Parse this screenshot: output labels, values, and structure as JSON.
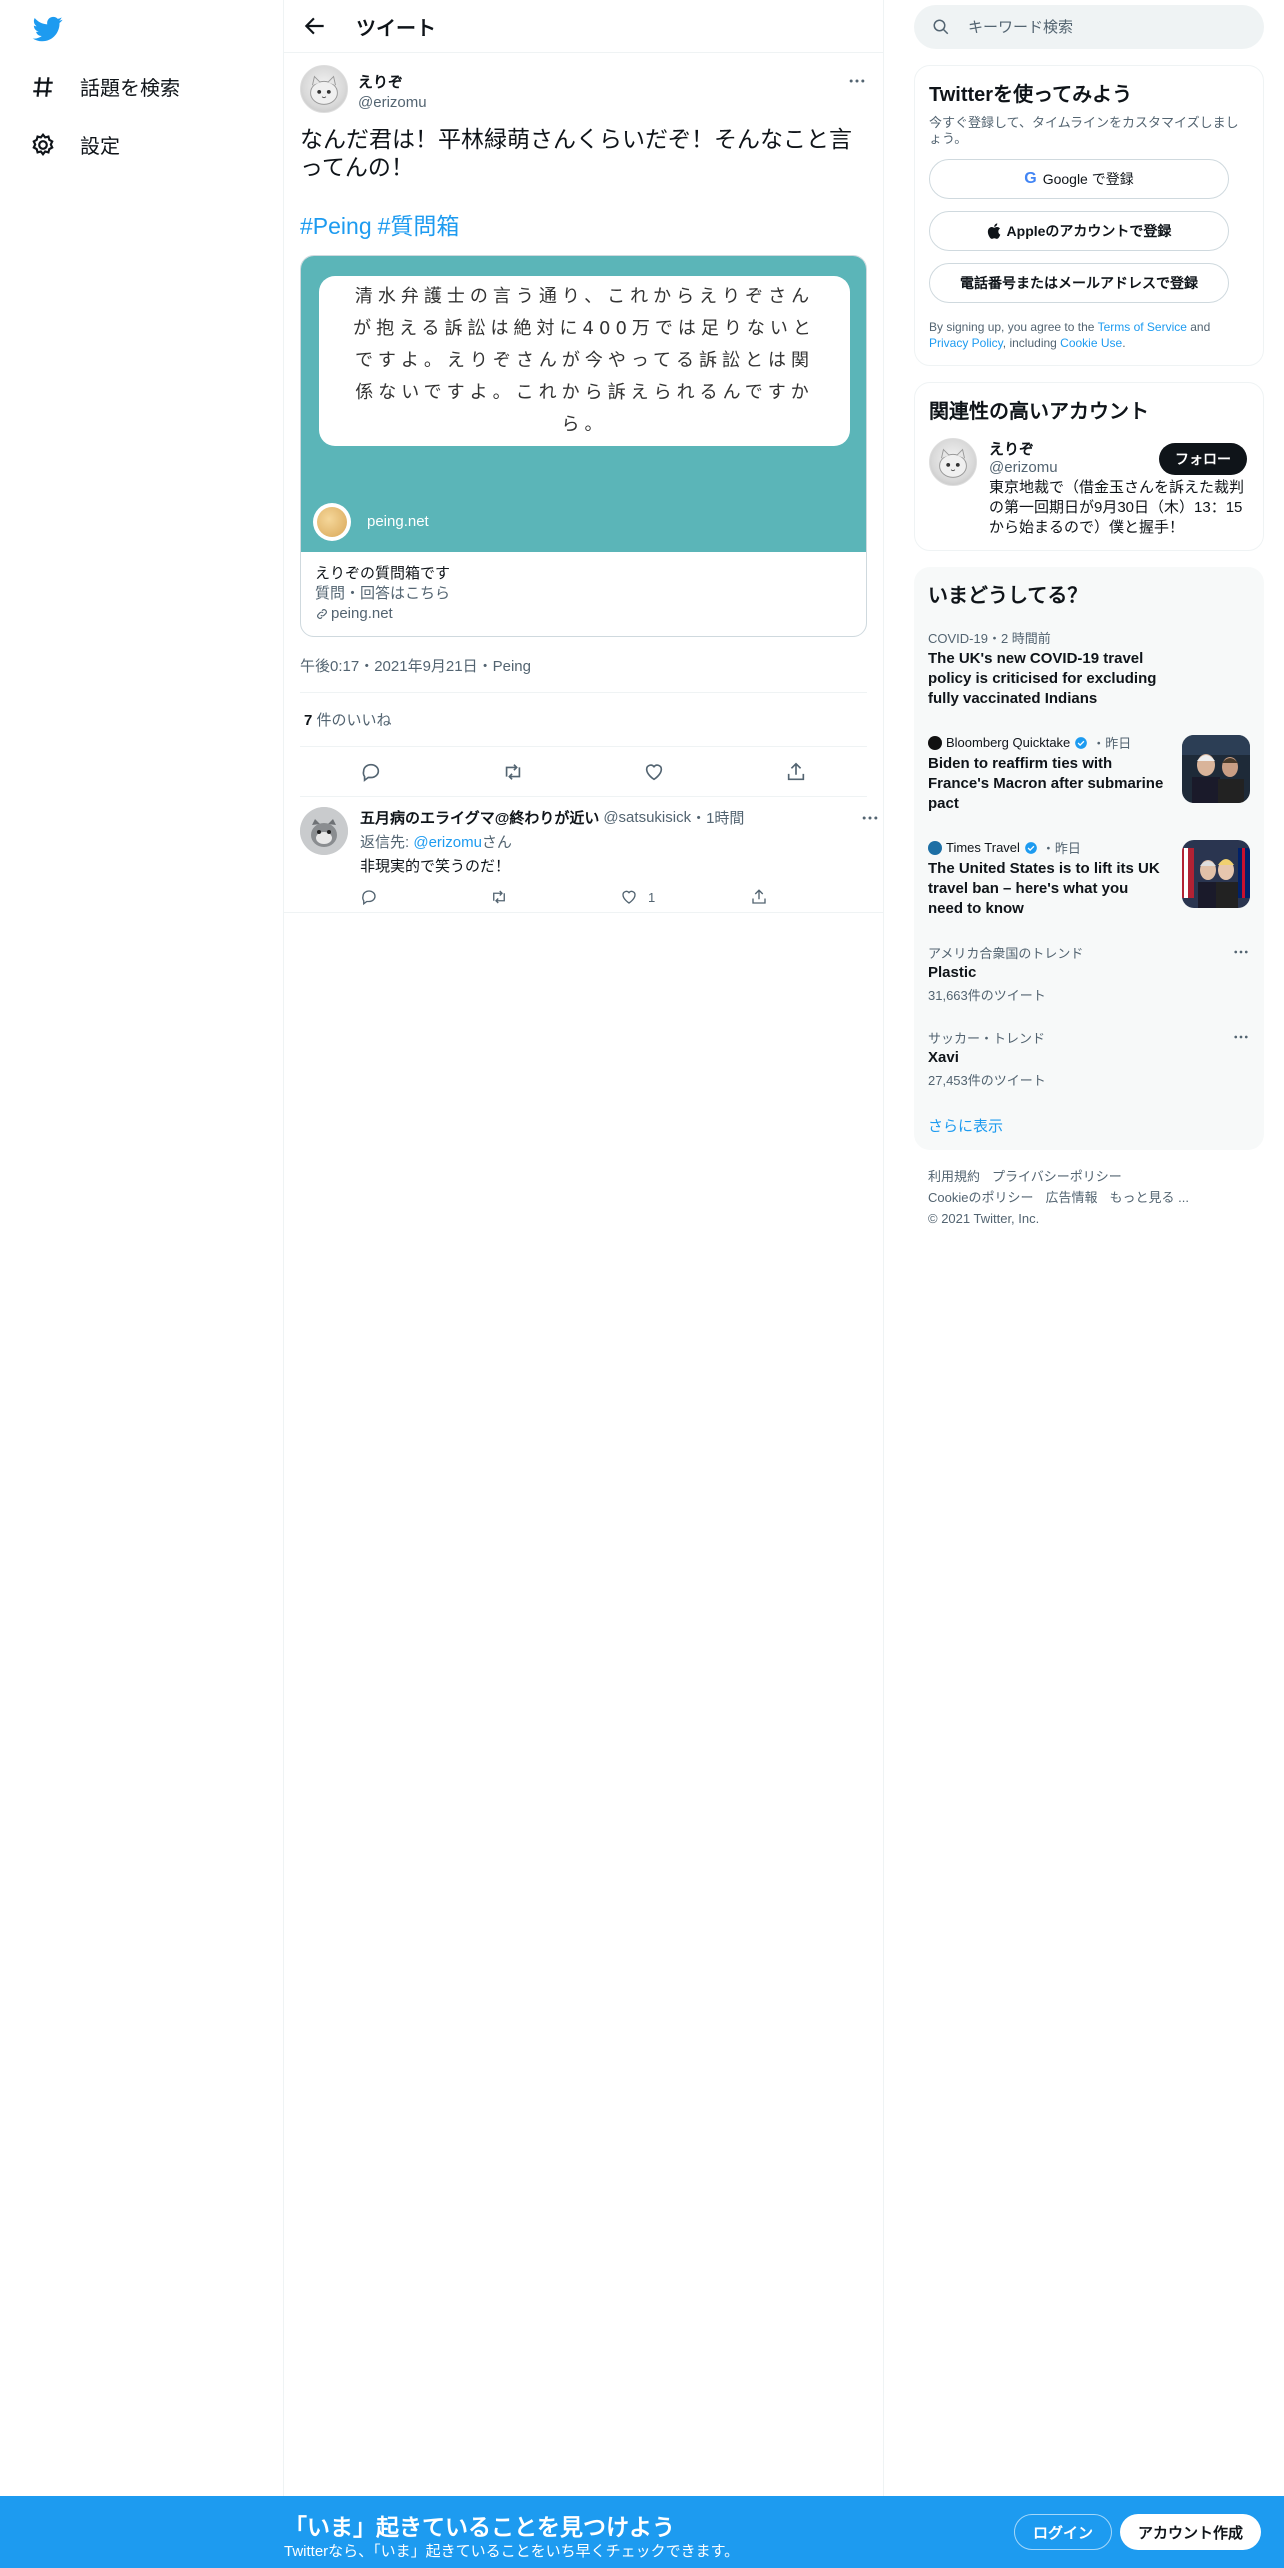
{
  "nav": {
    "explore": "話題を検索",
    "settings": "設定"
  },
  "header": {
    "title": "ツイート"
  },
  "tweet": {
    "name": "えりぞ",
    "handle": "@erizomu",
    "text": "なんだ君は！平林緑萌さんくらいだぞ！そんなこと言ってんの！",
    "tags": [
      "#Peing",
      "#質問箱"
    ],
    "card": {
      "image_text": "清水弁護士の言う通り、これからえりぞさんが抱える訴訟は絶対に400万では足りないとですよ。えりぞさんが今やってる訴訟とは関係ないですよ。これから訴えられるんですから。",
      "image_site": "peing.net",
      "title": "えりぞの質問箱です",
      "description": "質問・回答はこちら",
      "domain": "peing.net"
    },
    "timestamp": "午後0:17・2021年9月21日・Peing",
    "likes_count": "7",
    "likes_label": " 件のいいね"
  },
  "reply": {
    "name": "五月病のエライグマ@終わりが近い",
    "handle": "@satsukisick",
    "time": "・1時間",
    "replying_prefix": "返信先: ",
    "replying_handle": "@erizomu",
    "replying_suffix": "さん",
    "text": "非現実的で笑うのだ！",
    "like_count": "1"
  },
  "search": {
    "placeholder": "キーワード検索"
  },
  "signup": {
    "title": "Twitterを使ってみよう",
    "subtitle": "今すぐ登録して、タイムラインをカスタマイズしましょう。",
    "google_g": "G",
    "google": "Google で登録",
    "apple": "Appleのアカウントで登録",
    "phone": "電話番号またはメールアドレスで登録",
    "legal_1": "By signing up, you agree to the ",
    "terms": "Terms of Service",
    "legal_2": " and ",
    "privacy": "Privacy Policy",
    "legal_3": ", including ",
    "cookie": "Cookie Use",
    "legal_4": "."
  },
  "related": {
    "title": "関連性の高いアカウント",
    "name": "えりぞ",
    "handle": "@erizomu",
    "follow": "フォロー",
    "bio": "東京地裁で（借金玉さんを訴えた裁判の第一回期日が9月30日（木）13：15から始まるので）僕と握手！"
  },
  "trends": {
    "title": "いまどうしてる？",
    "items": [
      {
        "meta": "COVID-19・2 時間前",
        "headline": "The UK's new COVID-19 travel policy is criticised for excluding fully vaccinated Indians"
      },
      {
        "source": "Bloomberg Quicktake",
        "time": "・昨日",
        "headline": "Biden to reaffirm ties with France's Macron after submarine pact"
      },
      {
        "source": "Times Travel",
        "time": "・昨日",
        "headline": "The United States is to lift its UK travel ban – here's what you need to know"
      },
      {
        "meta": "アメリカ合衆国のトレンド",
        "name": "Plastic",
        "count": "31,663件のツイート"
      },
      {
        "meta": "サッカー・トレンド",
        "name": "Xavi",
        "count": "27,453件のツイート"
      }
    ],
    "show_more": "さらに表示"
  },
  "footer": {
    "terms": "利用規約",
    "privacy": "プライバシーポリシー",
    "cookie": "Cookieのポリシー",
    "ads": "広告情報",
    "more": "もっと見る ...",
    "copyright": "© 2021 Twitter, Inc."
  },
  "bottom": {
    "title": "「いま」起きていることを見つけよう",
    "subtitle": "Twitterなら、「いま」起きていることをいち早くチェックできます。",
    "login": "ログイン",
    "signup": "アカウント作成"
  },
  "colors": {
    "accent": "#1d9bf0",
    "card_bg": "#5bb5b8",
    "text": "#0f1419",
    "muted": "#536471"
  }
}
